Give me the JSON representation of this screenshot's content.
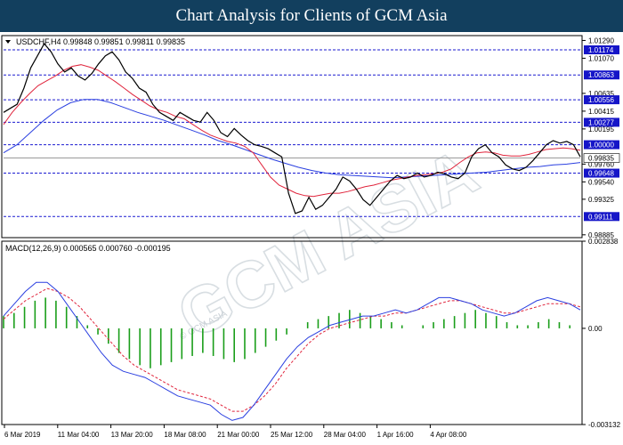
{
  "banner": {
    "title": "Chart Analysis for Clients of GCM Asia"
  },
  "watermark": {
    "text": "GCM ASIA",
    "sub": "© GCM ASIA"
  },
  "colors": {
    "price_line": "#000000",
    "ma_fast": "#e0243c",
    "ma_slow": "#2a3fe0",
    "level_line": "#1a1ad0",
    "level_box": "#1515c8",
    "macd_hist": "#1a9e1a",
    "macd_signal": "#e0243c",
    "macd_line": "#2a3fe0",
    "current_box": "#ffffff"
  },
  "chart_data": [
    {
      "type": "candlestick",
      "symbol": "USDCHF,H4",
      "header": "USDCHF,H4  0.99848 0.99851 0.99811 0.99835",
      "ohlc": {
        "open": 0.99848,
        "high": 0.99851,
        "low": 0.99811,
        "close": 0.99835
      },
      "ylim": [
        0.9885,
        1.0135
      ],
      "y_ticks": [
        "1.01290",
        "1.01070",
        "1.00635",
        "1.00415",
        "1.00195",
        "0.99760",
        "0.99540",
        "0.99325",
        "0.98885"
      ],
      "x_ticks": [
        "6 Mar 2019",
        "11 Mar 04:00",
        "13 Mar 20:00",
        "18 Mar 08:00",
        "21 Mar 00:00",
        "25 Mar 12:00",
        "28 Mar 04:00",
        "1 Apr 16:00",
        "4 Apr 08:00"
      ],
      "levels": [
        "1.01174",
        "1.00863",
        "1.00556",
        "1.00277",
        "1.00000",
        "0.99648",
        "0.99111"
      ],
      "current_price": "0.99835",
      "price": [
        1.004,
        1.0045,
        1.005,
        1.007,
        1.0095,
        1.011,
        1.0125,
        1.0115,
        1.01,
        1.009,
        1.0095,
        1.0085,
        1.008,
        1.0088,
        1.01,
        1.011,
        1.0115,
        1.0105,
        1.009,
        1.0082,
        1.007,
        1.0065,
        1.005,
        1.004,
        1.0035,
        1.003,
        1.004,
        1.0035,
        1.003,
        1.0028,
        1.004,
        1.003,
        1.0015,
        1.001,
        1.002,
        1.0012,
        1.0005,
        1.0,
        0.9998,
        0.9995,
        0.999,
        0.9985,
        0.994,
        0.9915,
        0.9918,
        0.9935,
        0.992,
        0.9925,
        0.9935,
        0.9945,
        0.996,
        0.9955,
        0.9945,
        0.9932,
        0.9925,
        0.9935,
        0.9945,
        0.9955,
        0.9962,
        0.9958,
        0.996,
        0.9965,
        0.996,
        0.9962,
        0.9966,
        0.9964,
        0.996,
        0.9958,
        0.9965,
        0.9985,
        0.9995,
        1.0,
        0.999,
        0.9985,
        0.9975,
        0.997,
        0.9968,
        0.9972,
        0.998,
        0.999,
        1.0,
        1.0005,
        1.0002,
        1.0004,
        1.0,
        0.9985
      ],
      "ma_fast": [
        1.0025,
        1.004,
        1.0052,
        1.0063,
        1.0073,
        1.0079,
        1.0085,
        1.0092,
        1.0097,
        1.0099,
        1.0096,
        1.0092,
        1.0085,
        1.0078,
        1.007,
        1.0062,
        1.0055,
        1.0048,
        1.0043,
        1.004,
        1.0035,
        1.0032,
        1.0025,
        1.0018,
        1.0012,
        1.0008,
        1.0004,
        1.0002,
        0.9998,
        0.999,
        0.9975,
        0.996,
        0.995,
        0.9945,
        0.994,
        0.9937,
        0.9936,
        0.9938,
        0.994,
        0.994,
        0.9942,
        0.9945,
        0.9948,
        0.995,
        0.9953,
        0.9956,
        0.9958,
        0.996,
        0.9962,
        0.9963,
        0.9964,
        0.9966,
        0.997,
        0.9978,
        0.9985,
        0.999,
        0.9991,
        0.999,
        0.9987,
        0.9986,
        0.9986,
        0.9988,
        0.9991,
        0.9994,
        0.9995,
        0.9996,
        0.9995,
        0.9993
      ],
      "ma_slow": [
        0.999,
        1.0,
        1.0015,
        1.003,
        1.0043,
        1.0052,
        1.0056,
        1.0056,
        1.0052,
        1.0046,
        1.004,
        1.0035,
        1.003,
        1.0024,
        1.0018,
        1.0012,
        1.0005,
        1.0,
        0.9994,
        0.9988,
        0.9982,
        0.9977,
        0.9972,
        0.9968,
        0.9965,
        0.9963,
        0.9962,
        0.9961,
        0.996,
        0.9959,
        0.996,
        0.9961,
        0.9962,
        0.9963,
        0.9964,
        0.9965,
        0.9966,
        0.9968,
        0.997,
        0.9972,
        0.9973,
        0.9975,
        0.9976,
        0.9978
      ],
      "title": "",
      "xlabel": "",
      "ylabel": ""
    },
    {
      "type": "bar",
      "indicator": "MACD(12,26,9)",
      "header": "MACD(12,26,9)  0.000565 0.000760 -0.000195",
      "values": {
        "macd": 0.000565,
        "signal": 0.00076,
        "histogram": -0.000195
      },
      "ylim": [
        -0.003132,
        0.002838
      ],
      "y_ticks": [
        "0.002838",
        "0.00",
        "-0.003132"
      ],
      "histogram": [
        0.0004,
        0.0005,
        0.0007,
        0.0009,
        0.001,
        0.0009,
        0.0007,
        0.0004,
        0.0001,
        -0.0002,
        -0.0005,
        -0.0008,
        -0.001,
        -0.0012,
        -0.0013,
        -0.0012,
        -0.0011,
        -0.001,
        -0.0009,
        -0.0008,
        -0.0009,
        -0.001,
        -0.0011,
        -0.001,
        -0.0008,
        -0.0006,
        -0.0004,
        -0.0002,
        0.0,
        0.0002,
        0.0003,
        0.0004,
        0.0005,
        0.0006,
        0.0005,
        0.0004,
        0.0003,
        0.0002,
        0.0001,
        0.0,
        0.0001,
        0.0002,
        0.0003,
        0.0004,
        0.0005,
        0.0006,
        0.0005,
        0.0004,
        0.0002,
        0.0001,
        0.0001,
        0.0002,
        0.0003,
        0.0002,
        0.0001,
        0.0
      ],
      "macd_line": [
        0.0004,
        0.0008,
        0.0012,
        0.0015,
        0.0015,
        0.0012,
        0.0007,
        0.0002,
        -0.0003,
        -0.0008,
        -0.0012,
        -0.0014,
        -0.0015,
        -0.0016,
        -0.0018,
        -0.002,
        -0.0022,
        -0.0023,
        -0.0024,
        -0.0025,
        -0.0028,
        -0.003,
        -0.0029,
        -0.0025,
        -0.002,
        -0.0015,
        -0.001,
        -0.0006,
        -0.0003,
        -0.0001,
        0.0001,
        0.0002,
        0.0003,
        0.0004,
        0.0004,
        0.0005,
        0.0006,
        0.0005,
        0.0006,
        0.0008,
        0.001,
        0.001,
        0.0009,
        0.0008,
        0.0006,
        0.0005,
        0.0004,
        0.0005,
        0.0007,
        0.0009,
        0.001,
        0.0009,
        0.0008,
        0.0006
      ],
      "signal_line": [
        0.0003,
        0.0006,
        0.0009,
        0.0011,
        0.0013,
        0.0012,
        0.001,
        0.0007,
        0.0003,
        -0.0001,
        -0.0005,
        -0.0009,
        -0.0012,
        -0.0014,
        -0.0016,
        -0.0018,
        -0.002,
        -0.0021,
        -0.0022,
        -0.0023,
        -0.0025,
        -0.0027,
        -0.0027,
        -0.0025,
        -0.0022,
        -0.0018,
        -0.0013,
        -0.0009,
        -0.0005,
        -0.0002,
        0.0,
        0.0001,
        0.0002,
        0.0003,
        0.0004,
        0.0004,
        0.0005,
        0.0005,
        0.0006,
        0.0007,
        0.0008,
        0.0009,
        0.0009,
        0.0008,
        0.0007,
        0.0006,
        0.0005,
        0.0005,
        0.0006,
        0.0007,
        0.0008,
        0.0008,
        0.0008,
        0.0007
      ]
    }
  ]
}
